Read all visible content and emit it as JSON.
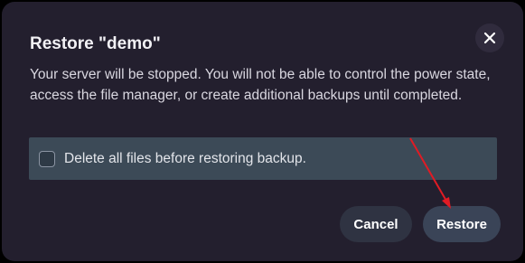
{
  "dialog": {
    "title": "Restore \"demo\"",
    "description": "Your server will be stopped. You will not be able to control the power state, access the file manager, or create additional backups until completed.",
    "option": {
      "label": "Delete all files before restoring backup.",
      "checked": false
    },
    "buttons": {
      "cancel": "Cancel",
      "restore": "Restore"
    },
    "close_icon": "close-icon"
  },
  "annotation": {
    "arrow_color": "#e01b24"
  }
}
